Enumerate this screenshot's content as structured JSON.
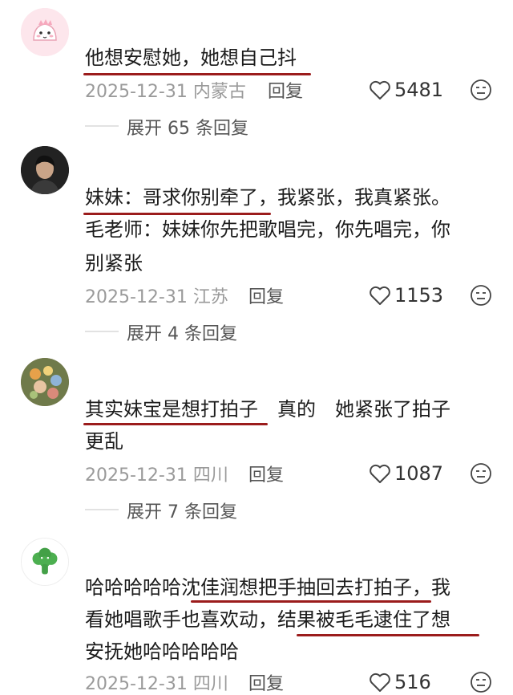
{
  "comments": [
    {
      "lines": [
        "他想安慰她，她想自己抖"
      ],
      "date": "2025-12-31",
      "location": "内蒙古",
      "reply": "回复",
      "likes": "5481",
      "expand": "展开 65 条回复"
    },
    {
      "lines": [
        "妹妹：哥求你别牵了，我紧张，我真紧张。",
        "毛老师：妹妹你先把歌唱完，你先唱完，你",
        "别紧张"
      ],
      "date": "2025-12-31",
      "location": "江苏",
      "reply": "回复",
      "likes": "1153",
      "expand": "展开 4 条回复"
    },
    {
      "lines": [
        "其实妹宝是想打拍子　真的　她紧张了拍子",
        "更乱"
      ],
      "date": "2025-12-31",
      "location": "四川",
      "reply": "回复",
      "likes": "1087",
      "expand": "展开 7 条回复"
    },
    {
      "lines": [
        "哈哈哈哈哈沈佳润想把手抽回去打拍子，我",
        "看她唱歌手也喜欢动，结果被毛毛逮住了想",
        "安抚她哈哈哈哈哈"
      ],
      "date": "2025-12-31",
      "location": "四川",
      "reply": "回复",
      "likes": "516"
    }
  ],
  "colors": {
    "underline": "#9b1c1c",
    "meta": "#9a9a9a"
  },
  "icons": {
    "like": "heart-outline-icon",
    "emoji": "neutral-face-icon"
  }
}
